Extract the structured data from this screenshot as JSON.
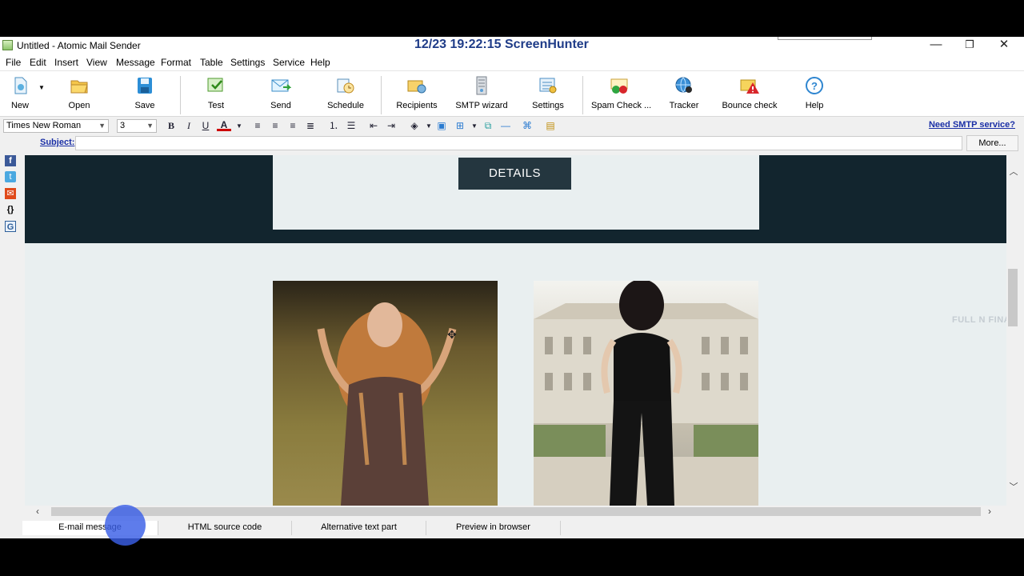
{
  "window": {
    "title": "Untitled - Atomic Mail Sender",
    "overlay_text": "12/23  19:22:15  ScreenHunter",
    "minimize_glyph": "—",
    "maximize_glyph": "❐",
    "close_glyph": "✕"
  },
  "menu": [
    "File",
    "Edit",
    "Insert",
    "View",
    "Message",
    "Format",
    "Table",
    "Settings",
    "Service",
    "Help"
  ],
  "toolbar": {
    "new": "New",
    "open": "Open",
    "save": "Save",
    "test": "Test",
    "send": "Send",
    "schedule": "Schedule",
    "recipients": "Recipients",
    "smtp_wizard": "SMTP wizard",
    "settings": "Settings",
    "spam_check": "Spam Check ...",
    "tracker": "Tracker",
    "bounce_check": "Bounce check",
    "help": "Help"
  },
  "format": {
    "font": "Times New Roman",
    "size": "3",
    "bold": "B",
    "italic": "I",
    "underline": "U",
    "font_color": "A",
    "need_smtp": "Need SMTP service?"
  },
  "subject": {
    "label": "Subject:",
    "value": "",
    "more": "More..."
  },
  "left_icons": [
    "facebook-icon",
    "twitter-icon",
    "email-icon",
    "braces-icon",
    "google-icon"
  ],
  "left_glyphs": {
    "braces": "{}",
    "google": "G"
  },
  "email": {
    "details_button": "DETAILS",
    "watermark": "FULL N FINAL"
  },
  "tabs": [
    "E-mail message",
    "HTML source code",
    "Alternative text part",
    "Preview in browser"
  ],
  "colors": {
    "banner_dark": "#12252e",
    "details_button": "#24363f",
    "link_blue": "#1a2fa6",
    "click_indicator": "#3a5fe6"
  }
}
